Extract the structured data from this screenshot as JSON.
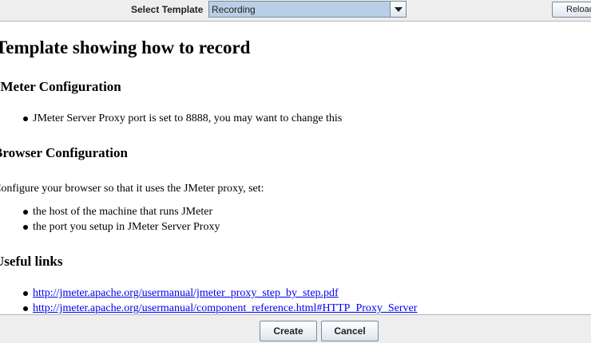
{
  "toolbar": {
    "select_label": "Select Template",
    "template_value": "Recording",
    "reload_label": "Reload"
  },
  "content": {
    "title": "Template showing how to record",
    "jmeter_heading": "JMeter Configuration",
    "jmeter_items": [
      "JMeter Server Proxy port is set to 8888, you may want to change this"
    ],
    "browser_heading": "Browser Configuration",
    "browser_intro": "Configure your browser so that it uses the JMeter proxy, set:",
    "browser_items": [
      "the host of the machine that runs JMeter",
      "the port you setup in JMeter Server Proxy"
    ],
    "links_heading": "Useful links",
    "links": [
      "http://jmeter.apache.org/usermanual/jmeter_proxy_step_by_step.pdf",
      "http://jmeter.apache.org/usermanual/component_reference.html#HTTP_Proxy_Server"
    ]
  },
  "buttons": {
    "create": "Create",
    "cancel": "Cancel"
  }
}
